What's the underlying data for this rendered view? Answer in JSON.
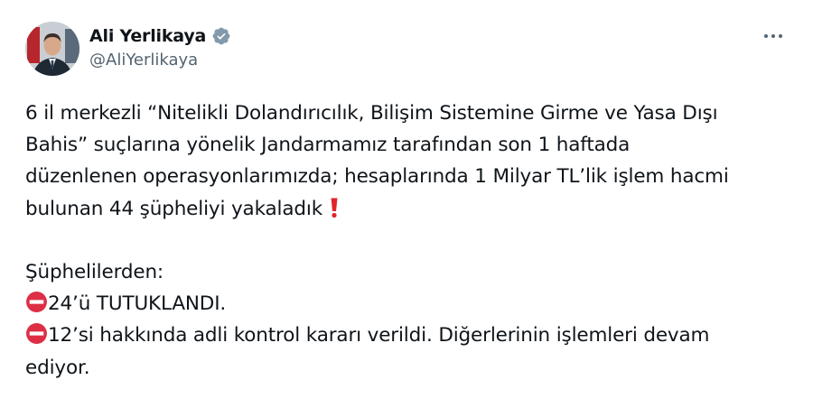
{
  "author": {
    "display_name": "Ali Yerlikaya",
    "handle": "@AliYerlikaya",
    "verified_badge_color": "#829aab"
  },
  "tweet": {
    "paragraph1": [
      "6 il merkezli “Nitelikli Dolandırıcılık, Bilişim Sistemine Girme ve Yasa Dışı",
      "Bahis” suçlarına yönelik Jandarmamız tarafından son 1 haftada",
      "düzenlenen  operasyonlarımızda; hesaplarında 1 Milyar TL’lik işlem hacmi",
      "bulunan 44 şüpheliyi yakaladık "
    ],
    "heading": "Şüphelilerden:",
    "item1": "24’ü TUTUKLANDI.",
    "item2_line1": "12’si hakkında adli kontrol kararı verildi. Diğerlerinin işlemleri devam",
    "item2_line2": "ediyor."
  },
  "colors": {
    "exclamation": "#e0242a",
    "no_entry": "#dd2e44"
  }
}
